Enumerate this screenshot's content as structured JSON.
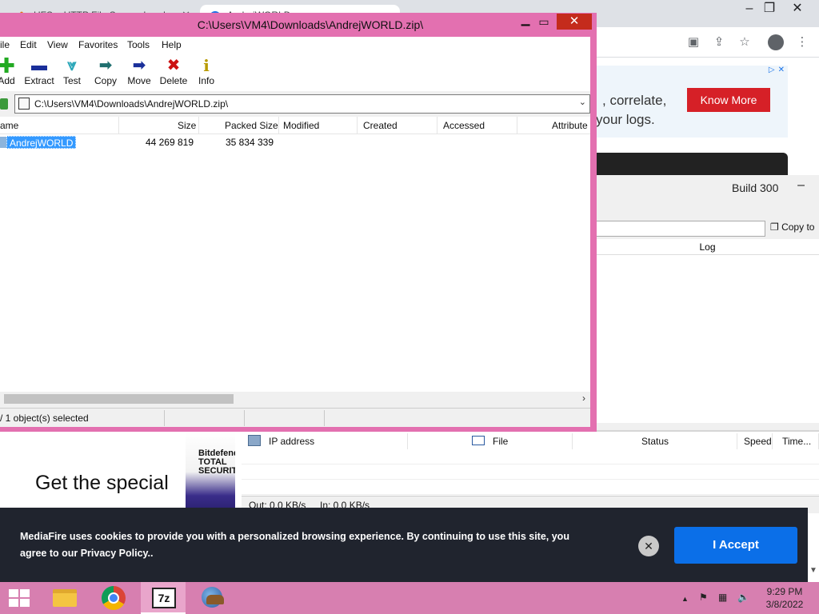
{
  "browser": {
    "tabs": [
      {
        "label": "HFS ~ HTTP File Server downlo"
      },
      {
        "label": "AndrejWORLD"
      }
    ],
    "window_buttons": {
      "minimize": "–",
      "restore": "❐",
      "close": "✕"
    },
    "toolbar_icons": [
      "capture-icon",
      "share-icon",
      "bookmark-star-icon",
      "profile-icon",
      "menu-icon"
    ],
    "ad": {
      "line1": ", correlate,",
      "line2": "your logs.",
      "button": "Know More",
      "adchoices": "▷✕"
    },
    "promo": {
      "title": "Get the special",
      "ad_text": "Bitdefender TOTAL SECURITY"
    }
  },
  "hfs": {
    "build": "Build 300",
    "minimize": "–",
    "copy_button": "Copy to",
    "log_header": "Log",
    "connections_columns": [
      "IP address",
      "File",
      "Status",
      "Speed",
      "Time..."
    ],
    "status": {
      "out": "Out: 0.0 KB/s",
      "in": "In: 0.0 KB/s"
    }
  },
  "zip": {
    "title": "C:\\Users\\VM4\\Downloads\\AndrejWORLD.zip\\",
    "menu": [
      "File",
      "Edit",
      "View",
      "Favorites",
      "Tools",
      "Help"
    ],
    "menu_visible": [
      "ile",
      "Edit",
      "View",
      "Favorites",
      "Tools",
      "Help"
    ],
    "toolbar": [
      {
        "label": "Add",
        "icon": "add-icon",
        "color": "#22aa22"
      },
      {
        "label": "Extract",
        "icon": "extract-icon",
        "color": "#1a2f9a"
      },
      {
        "label": "Test",
        "icon": "test-icon",
        "color": "#2aa6b8"
      },
      {
        "label": "Copy",
        "icon": "copy-icon",
        "color": "#1f6f6f"
      },
      {
        "label": "Move",
        "icon": "move-icon",
        "color": "#1a2f9a"
      },
      {
        "label": "Delete",
        "icon": "delete-icon",
        "color": "#cc1111"
      },
      {
        "label": "Info",
        "icon": "info-icon",
        "color": "#b89a00"
      }
    ],
    "path": "C:\\Users\\VM4\\Downloads\\AndrejWORLD.zip\\",
    "columns": [
      "Name",
      "Size",
      "Packed Size",
      "Modified",
      "Created",
      "Accessed",
      "Attributes"
    ],
    "columns_visible": [
      "ame",
      "Size",
      "Packed Size",
      "Modified",
      "Created",
      "Accessed",
      "Attribute"
    ],
    "rows": [
      {
        "name": "AndrejWORLD",
        "size": "44 269 819",
        "packed_size": "35 834 339",
        "modified": "",
        "created": "",
        "accessed": "",
        "attributes": ""
      }
    ],
    "status": "/ 1 object(s) selected"
  },
  "cookie": {
    "text": "MediaFire uses cookies to provide you with a personalized browsing experience. By continuing to use this site, you agree to our Privacy Policy..",
    "close": "✕",
    "accept": "I Accept"
  },
  "taskbar": {
    "apps": [
      "start-button",
      "file-explorer",
      "chrome",
      "7-zip",
      "hfs"
    ],
    "seven_zip_label": "7z",
    "tray": {
      "chevron": "▲"
    },
    "time": "9:29 PM",
    "date": "3/8/2022"
  },
  "colors": {
    "window_frame": "#e370b0",
    "taskbar": "#d77fb0",
    "selection": "#3399ff",
    "accept_button": "#0b6fe8",
    "know_more_button": "#d62027",
    "cookie_banner": "#20242e"
  }
}
